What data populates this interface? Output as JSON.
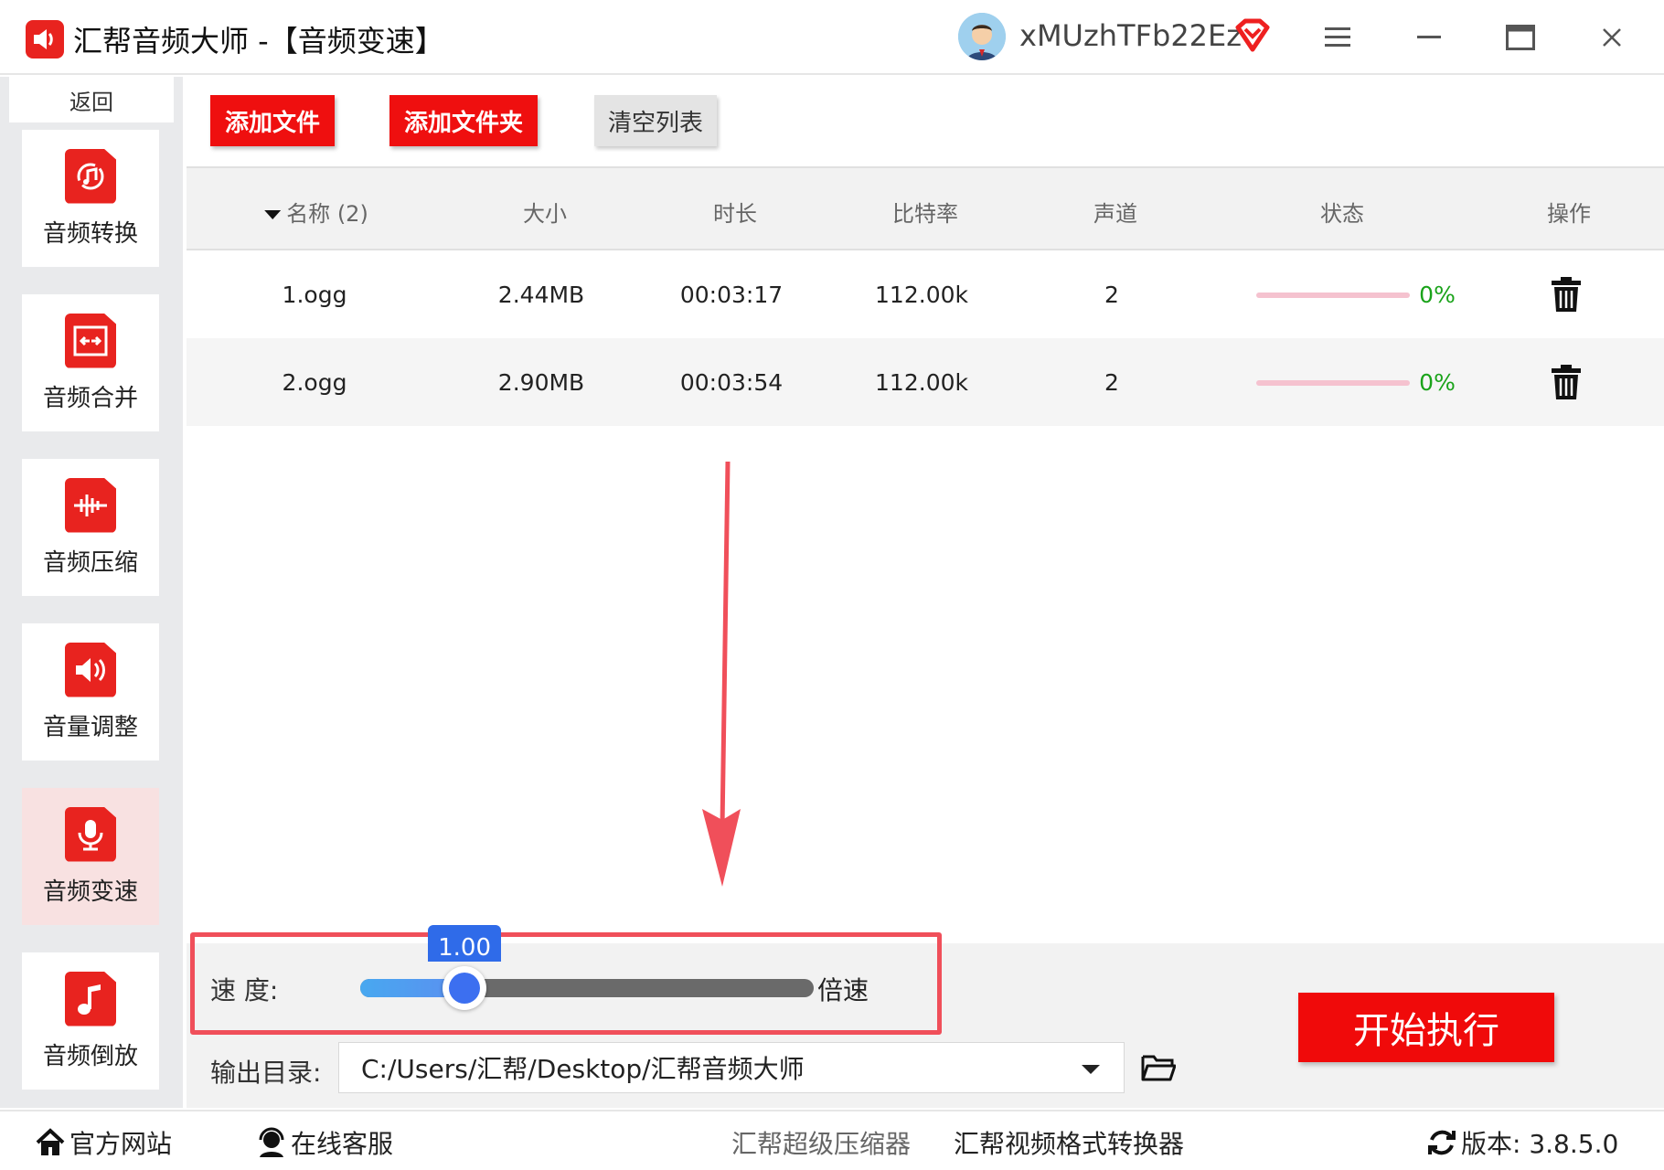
{
  "window": {
    "title": "汇帮音频大师  -【音频变速】",
    "username": "xMUzhTFb22Ez"
  },
  "sidebar": {
    "back_label": "返回",
    "items": [
      {
        "label": "音频转换",
        "icon": "audio-convert-icon"
      },
      {
        "label": "音频合并",
        "icon": "audio-merge-icon"
      },
      {
        "label": "音频压缩",
        "icon": "audio-compress-icon"
      },
      {
        "label": "音量调整",
        "icon": "volume-adjust-icon"
      },
      {
        "label": "音频变速",
        "icon": "audio-speed-icon",
        "active": true
      },
      {
        "label": "音频倒放",
        "icon": "audio-reverse-icon"
      }
    ]
  },
  "toolbar": {
    "add_file": "添加文件",
    "add_folder": "添加文件夹",
    "clear_list": "清空列表"
  },
  "table": {
    "columns": {
      "name": "名称 (2)",
      "size": "大小",
      "duration": "时长",
      "bitrate": "比特率",
      "channels": "声道",
      "status": "状态",
      "action": "操作"
    },
    "rows": [
      {
        "name": "1.ogg",
        "size": "2.44MB",
        "duration": "00:03:17",
        "bitrate": "112.00k",
        "channels": "2",
        "status": "0%",
        "progress": 0
      },
      {
        "name": "2.ogg",
        "size": "2.90MB",
        "duration": "00:03:54",
        "bitrate": "112.00k",
        "channels": "2",
        "status": "0%",
        "progress": 0
      }
    ]
  },
  "controls": {
    "speed_label": "速    度:",
    "speed_value": "1.00",
    "speed_fraction": 0.23,
    "speed_unit": "倍速",
    "output_label": "输出目录:",
    "output_path": "C:/Users/汇帮/Desktop/汇帮音频大师",
    "start_button": "开始执行"
  },
  "statusbar": {
    "website": "官方网站",
    "support": "在线客服",
    "link1": "汇帮超级压缩器",
    "link2": "汇帮视频格式转换器",
    "version": "版本:  3.8.5.0"
  },
  "colors": {
    "accent_red": "#ef0f0f",
    "slider_blue": "#3c6ff0",
    "status_green": "#1aa31a",
    "annotation": "#f04f5a"
  }
}
